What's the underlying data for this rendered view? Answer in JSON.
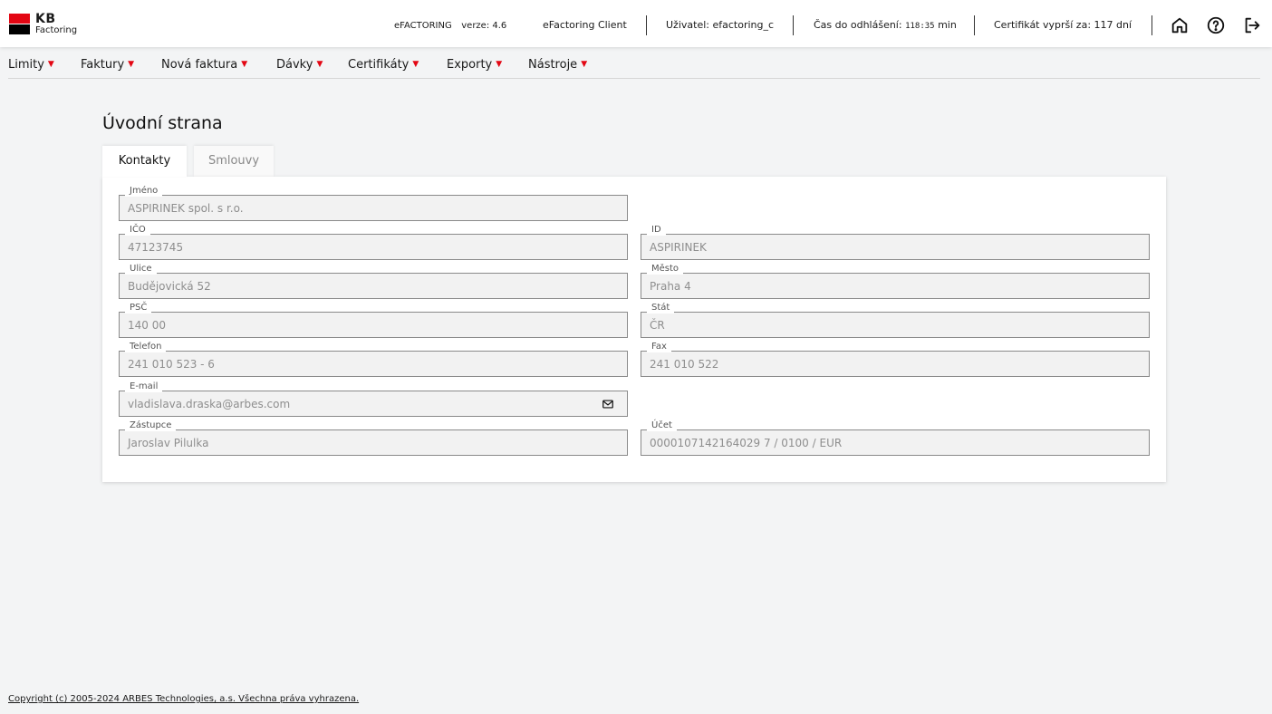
{
  "brand": {
    "name": "KB",
    "sub": "Factoring"
  },
  "header": {
    "app_version_prefix": "eFACTORING",
    "app_version": "verze: 4.6",
    "client": "eFactoring Client",
    "user": "Uživatel: efactoring_c",
    "logout_prefix": "Čas do odhlášení:",
    "logout_time": "118:35",
    "logout_unit": "min",
    "cert": "Certifikát vyprší za: 117 dní",
    "icons": [
      "home-icon",
      "help-icon",
      "logout-icon"
    ]
  },
  "nav": {
    "items": [
      {
        "label": "Limity"
      },
      {
        "label": "Faktury"
      },
      {
        "label": "Nová faktura"
      },
      {
        "label": "Dávky"
      },
      {
        "label": "Certifikáty"
      },
      {
        "label": "Exporty"
      },
      {
        "label": "Nástroje"
      }
    ]
  },
  "page": {
    "title": "Úvodní strana",
    "tabs": [
      {
        "label": "Kontakty",
        "active": true
      },
      {
        "label": "Smlouvy",
        "active": false
      }
    ]
  },
  "contacts": {
    "jmeno": {
      "label": "Jméno",
      "value": "ASPIRINEK spol. s r.o."
    },
    "ico": {
      "label": "IČO",
      "value": "47123745"
    },
    "id": {
      "label": "ID",
      "value": "ASPIRINEK"
    },
    "ulice": {
      "label": "Ulice",
      "value": "Budějovická 52"
    },
    "mesto": {
      "label": "Město",
      "value": "Praha 4"
    },
    "psc": {
      "label": "PSČ",
      "value": "140 00"
    },
    "stat": {
      "label": "Stát",
      "value": "ČR"
    },
    "telefon": {
      "label": "Telefon",
      "value": "241 010 523 - 6"
    },
    "fax": {
      "label": "Fax",
      "value": "241 010 522"
    },
    "email": {
      "label": "E-mail",
      "value": "vladislava.draska@arbes.com",
      "icon": "mail-icon"
    },
    "zastupce": {
      "label": "Zástupce",
      "value": "Jaroslav Pilulka"
    },
    "ucet": {
      "label": "Účet",
      "value": "0000107142164029 7 / 0100 / EUR"
    }
  },
  "footer": {
    "copyright": "Copyright (c) 2005-2024 ARBES Technologies, a.s. Všechna práva vyhrazena."
  },
  "colors": {
    "accent": "#e30613",
    "background": "#f3f4f5",
    "field_bg": "#f2f2f2"
  }
}
